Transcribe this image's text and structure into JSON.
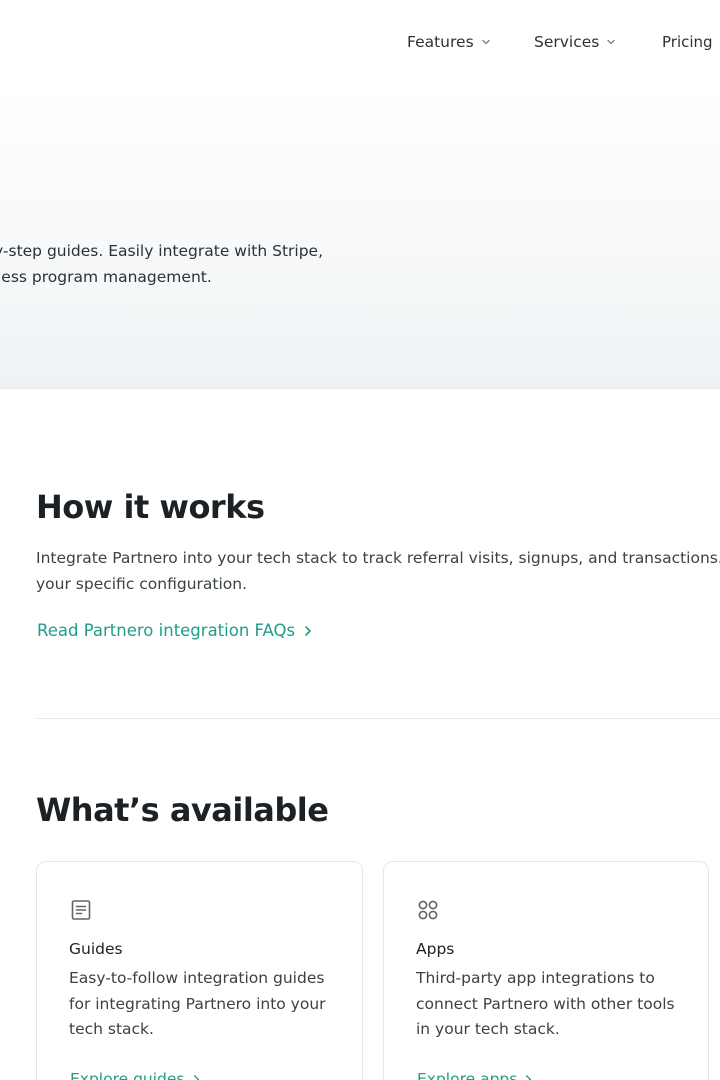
{
  "nav": {
    "features_label": "Features",
    "services_label": "Services",
    "pricing_label": "Pricing"
  },
  "hero": {
    "description_lines": [
      "y-step guides. Easily integrate with Stripe,",
      "less program management."
    ]
  },
  "how_it_works": {
    "title": "How it works",
    "description_lines": [
      "Integrate Partnero into your tech stack to track referral visits, signups, and transactions. Th",
      "your specific configuration."
    ],
    "faq_link": "Read Partnero integration FAQs"
  },
  "whats_available": {
    "title": "What’s available",
    "cards": [
      {
        "icon": "document-icon",
        "title": "Guides",
        "description_lines": [
          "Easy-to-follow integration guides",
          "for integrating Partnero into your",
          "tech stack."
        ],
        "link": "Explore guides"
      },
      {
        "icon": "apps-grid-icon",
        "title": "Apps",
        "description_lines": [
          "Third-party app integrations to",
          "connect Partnero with other tools",
          "in your tech stack."
        ],
        "link": "Explore apps"
      }
    ]
  },
  "colors": {
    "accent_link": "#1f9d8a",
    "text_primary": "#1b2125",
    "divider": "#e3e8ea"
  }
}
